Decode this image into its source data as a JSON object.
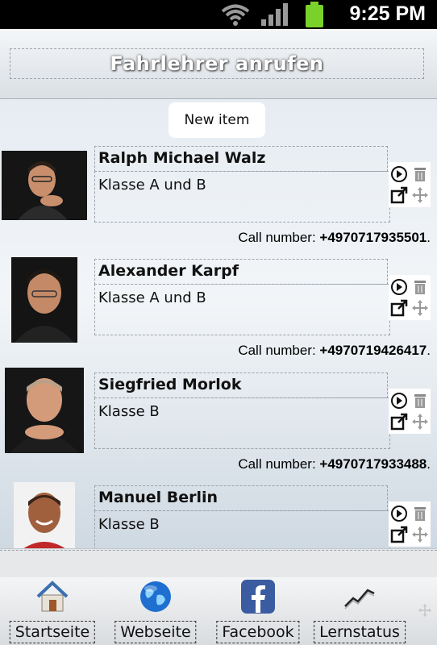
{
  "status_bar": {
    "time": "9:25 PM"
  },
  "header": {
    "title": "Fahrlehrer anrufen"
  },
  "new_item_label": "New item",
  "call_prefix": "Call number: ",
  "items": [
    {
      "name": "Ralph Michael Walz",
      "class": "Klasse A und B",
      "phone": "+4970717935501",
      "suffix": "."
    },
    {
      "name": "Alexander Karpf",
      "class": "Klasse A und B",
      "phone": "+4970719426417",
      "suffix": "."
    },
    {
      "name": "Siegfried Morlok",
      "class": "Klasse B",
      "phone": "+4970717933488",
      "suffix": "."
    },
    {
      "name": "Manuel Berlin",
      "class": "Klasse B",
      "phone": "",
      "suffix": ""
    }
  ],
  "tabs": [
    {
      "label": "Startseite",
      "icon": "home-icon"
    },
    {
      "label": "Webseite",
      "icon": "globe-icon"
    },
    {
      "label": "Facebook",
      "icon": "facebook-icon"
    },
    {
      "label": "Lernstatus",
      "icon": "chart-line-icon"
    }
  ]
}
